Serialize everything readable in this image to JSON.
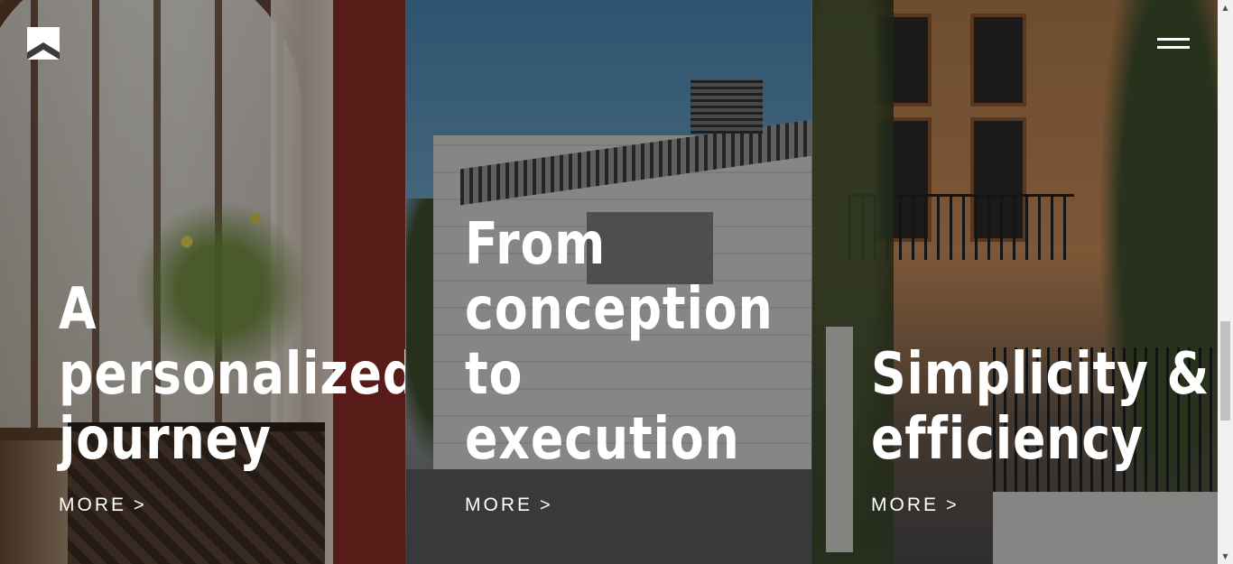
{
  "panels": [
    {
      "id": "personalized",
      "title": "A personalized journey",
      "more_label": "MORE",
      "more_icon": "chevron-right"
    },
    {
      "id": "conception",
      "title": "From conception to execution",
      "more_label": "MORE",
      "more_icon": "chevron-right"
    },
    {
      "id": "simplicity",
      "title": "Simplicity & efficiency",
      "more_label": "MORE",
      "more_icon": "chevron-right"
    }
  ],
  "header": {
    "logo_icon": "logo-mark",
    "menu_icon": "hamburger-menu"
  },
  "colors": {
    "text": "#ffffff",
    "overlay": "rgba(0,0,0,0.38)"
  },
  "scrollbar": {
    "position_fraction": 0.57
  }
}
